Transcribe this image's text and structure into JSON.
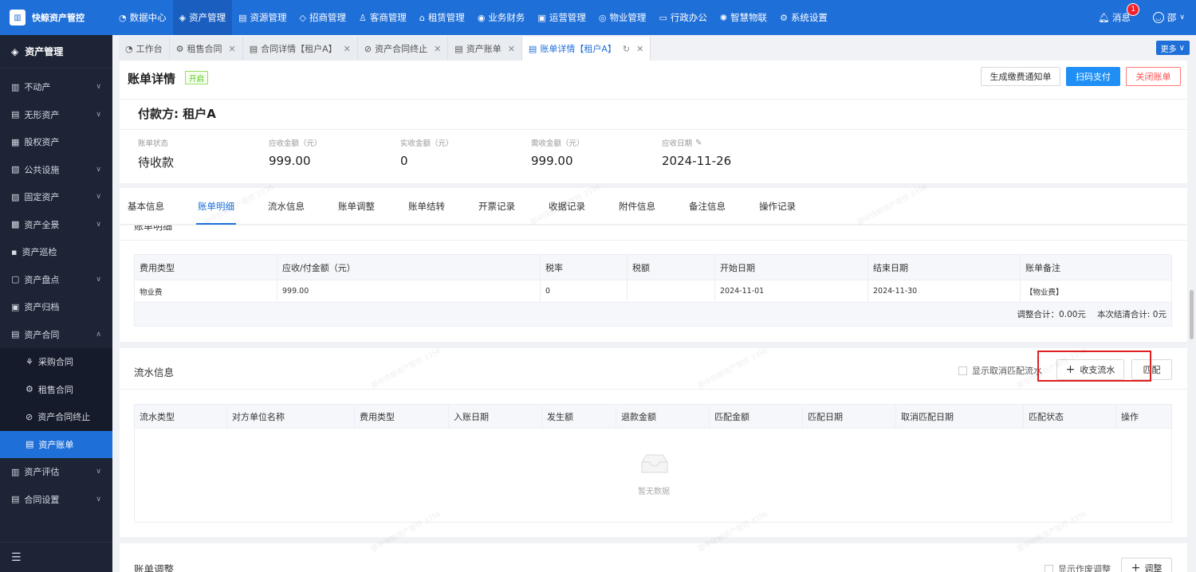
{
  "app": {
    "name": "快鲸资产管控",
    "logo_icon": "building-icon"
  },
  "top_nav": [
    {
      "label": "数据中心",
      "icon": "dashboard-icon",
      "active": false
    },
    {
      "label": "资产管理",
      "icon": "cube-icon",
      "active": true
    },
    {
      "label": "资源管理",
      "icon": "resource-icon",
      "active": false
    },
    {
      "label": "招商管理",
      "icon": "tag-icon",
      "active": false
    },
    {
      "label": "客商管理",
      "icon": "users-icon",
      "active": false
    },
    {
      "label": "租赁管理",
      "icon": "home-icon",
      "active": false
    },
    {
      "label": "业务财务",
      "icon": "finance-icon",
      "active": false
    },
    {
      "label": "运营管理",
      "icon": "operation-icon",
      "active": false
    },
    {
      "label": "物业管理",
      "icon": "property-icon",
      "active": false
    },
    {
      "label": "行政办公",
      "icon": "office-icon",
      "active": false
    },
    {
      "label": "智慧物联",
      "icon": "iot-icon",
      "active": false
    },
    {
      "label": "系统设置",
      "icon": "gear-icon",
      "active": false
    }
  ],
  "top_right": {
    "messages_label": "消息",
    "message_count": "1",
    "user_name": "邵"
  },
  "sidebar": {
    "title": "资产管理",
    "items": [
      {
        "label": "不动产",
        "icon": "building-icon",
        "chevron": "v"
      },
      {
        "label": "无形资产",
        "icon": "book-icon",
        "chevron": "v"
      },
      {
        "label": "股权资产",
        "icon": "equity-icon",
        "chevron": ""
      },
      {
        "label": "公共设施",
        "icon": "facility-icon",
        "chevron": "v"
      },
      {
        "label": "固定资产",
        "icon": "fixed-asset-icon",
        "chevron": "v"
      },
      {
        "label": "资产全景",
        "icon": "panorama-icon",
        "chevron": "v"
      },
      {
        "label": "资产巡检",
        "icon": "inspect-icon",
        "chevron": ""
      },
      {
        "label": "资产盘点",
        "icon": "inventory-icon",
        "chevron": "v"
      },
      {
        "label": "资产归档",
        "icon": "archive-icon",
        "chevron": ""
      },
      {
        "label": "资产合同",
        "icon": "contract-icon",
        "chevron": "^"
      }
    ],
    "sub_items": [
      {
        "label": "采购合同",
        "icon": "purchase-icon",
        "active": false
      },
      {
        "label": "租售合同",
        "icon": "lease-icon",
        "active": false
      },
      {
        "label": "资产合同终止",
        "icon": "terminate-icon",
        "active": false
      },
      {
        "label": "资产账单",
        "icon": "bill-icon",
        "active": true
      }
    ],
    "items_after": [
      {
        "label": "资产评估",
        "icon": "evaluate-icon",
        "chevron": "v"
      },
      {
        "label": "合同设置",
        "icon": "contract-settings-icon",
        "chevron": "v"
      }
    ]
  },
  "tabs": [
    {
      "label": "工作台",
      "closable": false,
      "active": false
    },
    {
      "label": "租售合同",
      "closable": true,
      "active": false
    },
    {
      "label": "合同详情【租户A】",
      "closable": true,
      "active": false
    },
    {
      "label": "资产合同终止",
      "closable": true,
      "active": false
    },
    {
      "label": "资产账单",
      "closable": true,
      "active": false
    },
    {
      "label": "账单详情【租户A】",
      "closable": true,
      "active": true
    }
  ],
  "tabs_more_label": "更多",
  "header": {
    "title": "账单详情",
    "status_tag": "开启",
    "buttons": {
      "notice": "生成缴费通知单",
      "scan_pay": "扫码支付",
      "close_bill": "关闭账单"
    },
    "payer": "付款方: 租户A",
    "stats": [
      {
        "label": "账单状态",
        "value": "待收款",
        "editable": false
      },
      {
        "label": "应收金额（元）",
        "value": "999.00",
        "editable": false
      },
      {
        "label": "实收金额（元）",
        "value": "0",
        "editable": false
      },
      {
        "label": "需收金额（元）",
        "value": "999.00",
        "editable": false
      },
      {
        "label": "应收日期",
        "value": "2024-11-26",
        "editable": true
      }
    ]
  },
  "detail_tabs": [
    "基本信息",
    "账单明细",
    "流水信息",
    "账单调整",
    "账单结转",
    "开票记录",
    "收据记录",
    "附件信息",
    "备注信息",
    "操作记录"
  ],
  "detail_tab_active": 1,
  "bill_detail": {
    "section_title": "账单明细",
    "columns": [
      "费用类型",
      "应收/付金额（元）",
      "税率",
      "税额",
      "开始日期",
      "结束日期",
      "账单备注"
    ],
    "rows": [
      [
        "物业费",
        "999.00",
        "0",
        "",
        "2024-11-01",
        "2024-11-30",
        "【物业费】"
      ]
    ],
    "adjust_total": "调整合计：0.00元",
    "settle_total": "本次结清合计: 0元"
  },
  "flow": {
    "title": "流水信息",
    "show_unmatch_label": "显示取消匹配流水",
    "add_button": "收支流水",
    "match_button": "匹配",
    "columns": [
      "流水类型",
      "对方单位名称",
      "费用类型",
      "入账日期",
      "发生额",
      "退款金额",
      "匹配金额",
      "匹配日期",
      "取消匹配日期",
      "匹配状态",
      "操作"
    ],
    "empty_text": "暂无数据"
  },
  "adjust": {
    "title": "账单调整",
    "show_void_label": "显示作废调整",
    "add_button": "调整"
  },
  "watermark": "邵中快鲸资产管控 3356"
}
